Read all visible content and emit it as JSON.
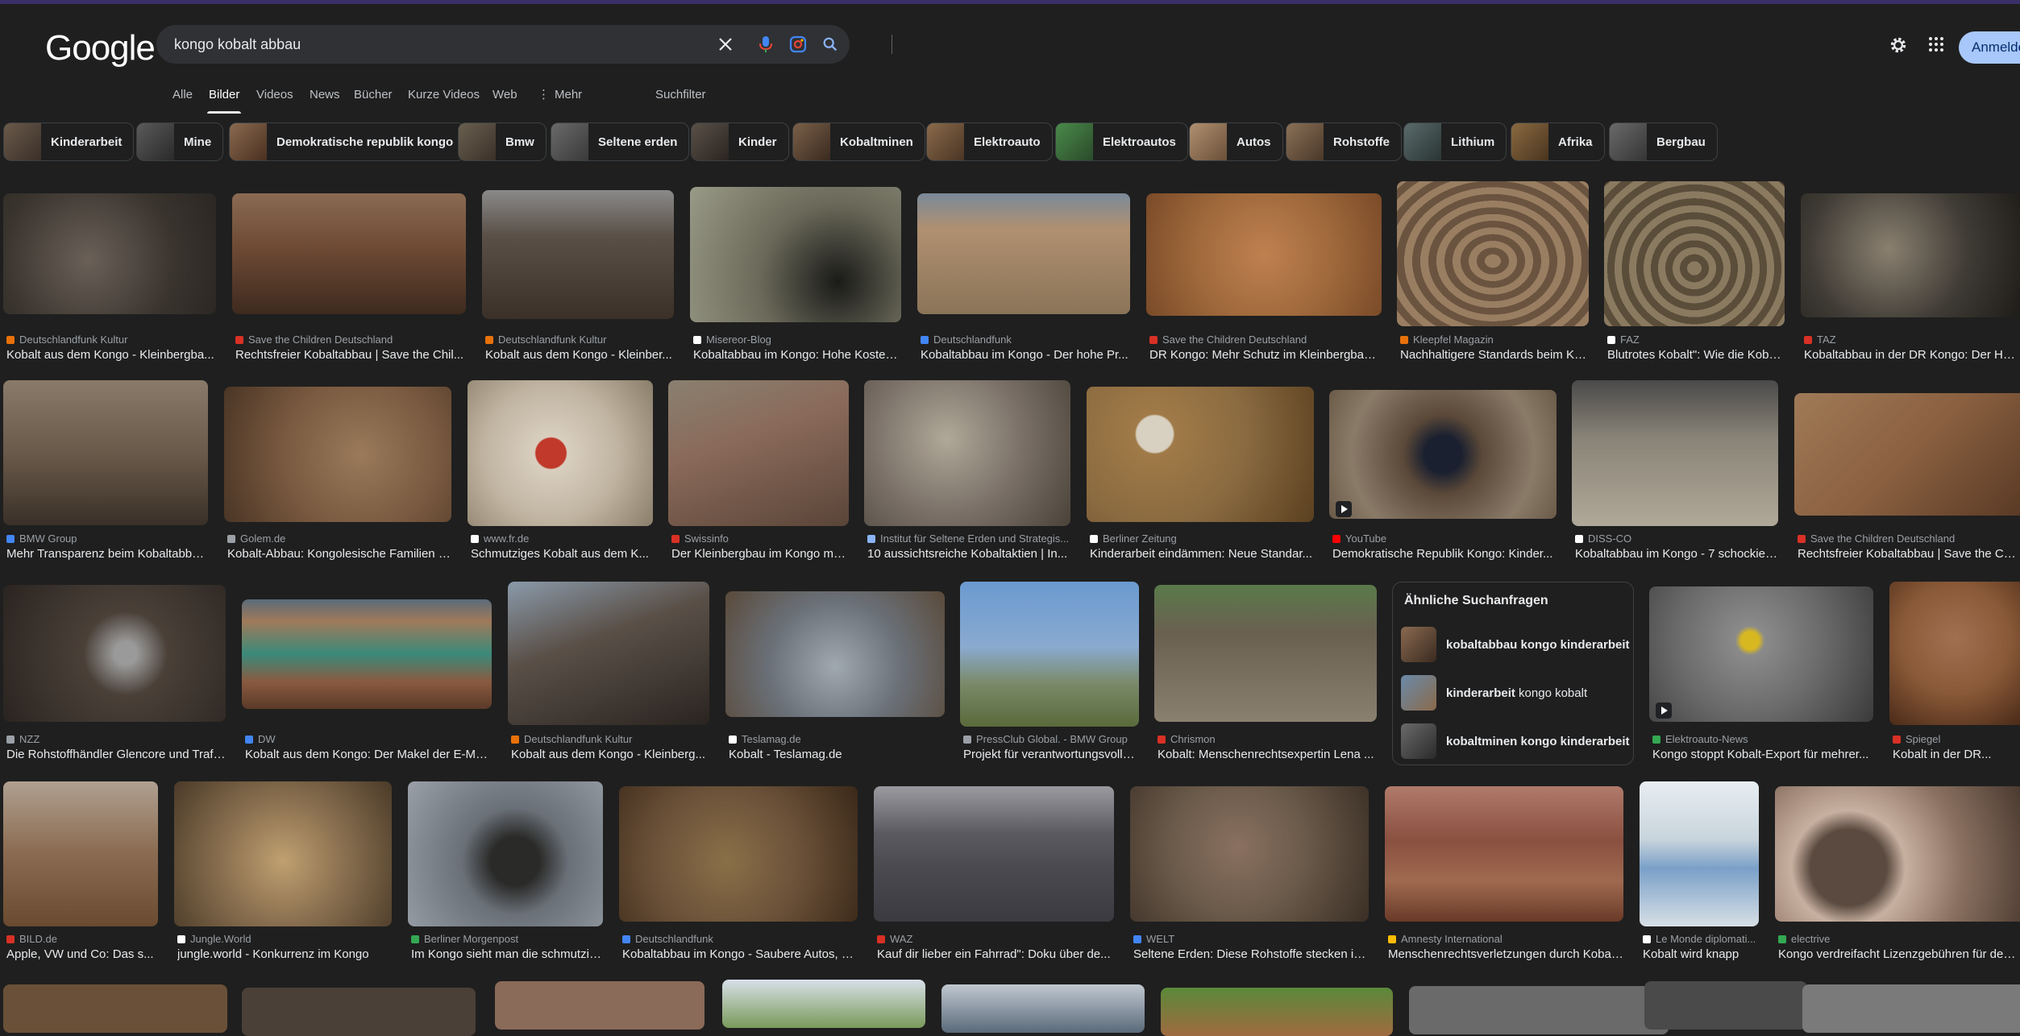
{
  "header": {
    "logo": "Google",
    "query": "kongo kobalt abbau",
    "signin": "Anmelden"
  },
  "tabs": [
    "Alle",
    "Bilder",
    "Videos",
    "News",
    "Bücher",
    "Kurze Videos",
    "Web",
    "Mehr",
    "Suchfilter"
  ],
  "chips": [
    "Kinderarbeit",
    "Mine",
    "Demokratische republik kongo",
    "Bmw",
    "Seltene erden",
    "Kinder",
    "Kobaltminen",
    "Elektroauto",
    "Elektroautos",
    "Autos",
    "Rohstoffe",
    "Lithium",
    "Afrika",
    "Bergbau"
  ],
  "results": [
    {
      "source": "Deutschlandfunk Kultur",
      "title": "Kobalt aus dem Kongo - Kleinbergba...",
      "color": "#4a4540"
    },
    {
      "source": "Save the Children Deutschland",
      "title": "Rechtsfreier Kobaltabbau | Save the Chil...",
      "color": "#6e4a35"
    },
    {
      "source": "Deutschlandfunk Kultur",
      "title": "Kobalt aus dem Kongo - Kleinber...",
      "color": "#5a5048"
    },
    {
      "source": "Misereor-Blog",
      "title": "Kobaltabbau im Kongo: Hohe Kosten ...",
      "color": "#6b6a5a"
    },
    {
      "source": "Deutschlandfunk",
      "title": "Kobaltabbau im Kongo - Der hohe Pr...",
      "color": "#8a7458"
    },
    {
      "source": "Save the Children Deutschland",
      "title": "DR Kongo: Mehr Schutz im Kleinbergbau ...",
      "color": "#a06a3c"
    },
    {
      "source": "Kleepfel Magazin",
      "title": "Nachhaltigere Standards beim Ko...",
      "color": "#8a6e55"
    },
    {
      "source": "FAZ",
      "title": "Blutrotes Kobalt\": Wie die Koba...",
      "color": "#6a5d48"
    },
    {
      "source": "TAZ",
      "title": "Kobaltabbau in der DR Kongo: Der Horr...",
      "color": "#3e3a34"
    },
    {
      "source": "BMW Group",
      "title": "Mehr Transparenz beim Kobaltabbau.",
      "color": "#6a5a4a"
    },
    {
      "source": "Golem.de",
      "title": "Kobalt-Abbau: Kongolesische Familien v...",
      "color": "#7a5a40"
    },
    {
      "source": "www.fr.de",
      "title": "Schmutziges Kobalt aus dem K...",
      "color": "#bfb3a0"
    },
    {
      "source": "Swissinfo",
      "title": "Der Kleinbergbau im Kongo mu...",
      "color": "#8a6a5a"
    },
    {
      "source": "Institut für Seltene Erden und Strategis...",
      "title": "10 aussichtsreiche Kobaltaktien | In...",
      "color": "#7a7068"
    },
    {
      "source": "Berliner Zeitung",
      "title": "Kinderarbeit eindämmen: Neue Standar...",
      "color": "#8a6a40"
    },
    {
      "source": "YouTube",
      "title": "Demokratische Republik Kongo: Kinder...",
      "color": "#5a4838"
    },
    {
      "source": "DISS-CO",
      "title": "Kobaltabbau im Kongo - 7 schockier...",
      "color": "#8a8478"
    },
    {
      "source": "Save the Children Deutschland",
      "title": "Rechtsfreier Kobaltabbau | Save the Chil...",
      "color": "#8a6040"
    },
    {
      "source": "NZZ",
      "title": "Die Rohstoffhändler Glencore und Trafi...",
      "color": "#4a4038"
    },
    {
      "source": "DW",
      "title": "Kobalt aus dem Kongo: Der Makel der E-Mo...",
      "color": "#8a5a40"
    },
    {
      "source": "Deutschlandfunk Kultur",
      "title": "Kobalt aus dem Kongo - Kleinberg...",
      "color": "#5a5048"
    },
    {
      "source": "Teslamag.de",
      "title": "Kobalt - Teslamag.de",
      "color": "#6a7078"
    },
    {
      "source": "PressClub Global. - BMW Group",
      "title": "Projekt für verantwortungsvolle...",
      "color": "#7a8a6a"
    },
    {
      "source": "Chrismon",
      "title": "Kobalt: Menschenrechtsexpertin Lena ...",
      "color": "#6a6050"
    },
    {
      "source": "Elektroauto-News",
      "title": "Kongo stoppt Kobalt-Export für mehrer...",
      "color": "#6a6a6a"
    },
    {
      "source": "Spiegel",
      "title": "Kobalt in der DR...",
      "color": "#8a5a38"
    },
    {
      "source": "BILD.de",
      "title": "Apple, VW und Co: Das s...",
      "color": "#8a6a50"
    },
    {
      "source": "Jungle.World",
      "title": "jungle.world - Konkurrenz im Kongo",
      "color": "#8a7050"
    },
    {
      "source": "Berliner Morgenpost",
      "title": "Im Kongo sieht man die schmutzig...",
      "color": "#6a7078"
    },
    {
      "source": "Deutschlandfunk",
      "title": "Kobaltabbau im Kongo - Saubere Autos, d...",
      "color": "#6a5038"
    },
    {
      "source": "WAZ",
      "title": "Kauf dir lieber ein Fahrrad\": Doku über de...",
      "color": "#4a4a50"
    },
    {
      "source": "WELT",
      "title": "Seltene Erden: Diese Rohstoffe stecken in...",
      "color": "#6a5a4a"
    },
    {
      "source": "Amnesty International",
      "title": "Menschenrechtsverletzungen durch Kobalt...",
      "color": "#8a5040"
    },
    {
      "source": "Le Monde diplomati...",
      "title": "Kobalt wird knapp",
      "color": "#c8d4dc"
    },
    {
      "source": "electrive",
      "title": "Kongo verdreifacht Lizenzgebühren für den ...",
      "color": "#5a4a40"
    }
  ],
  "related": {
    "heading": "Ähnliche Suchanfragen",
    "items": [
      {
        "bold": "kobaltabbau kongo kinderarbeit",
        "rest": ""
      },
      {
        "bold": "kinderarbeit",
        "rest": " kongo kobalt"
      },
      {
        "bold": "kobaltminen kongo kinderarbeit",
        "rest": ""
      }
    ]
  },
  "colors": {
    "background": "#1f1f1f",
    "searchbar": "#303134",
    "signin": "#a8c7fa",
    "text": "#e8eaed",
    "muted": "#9aa0a6"
  }
}
